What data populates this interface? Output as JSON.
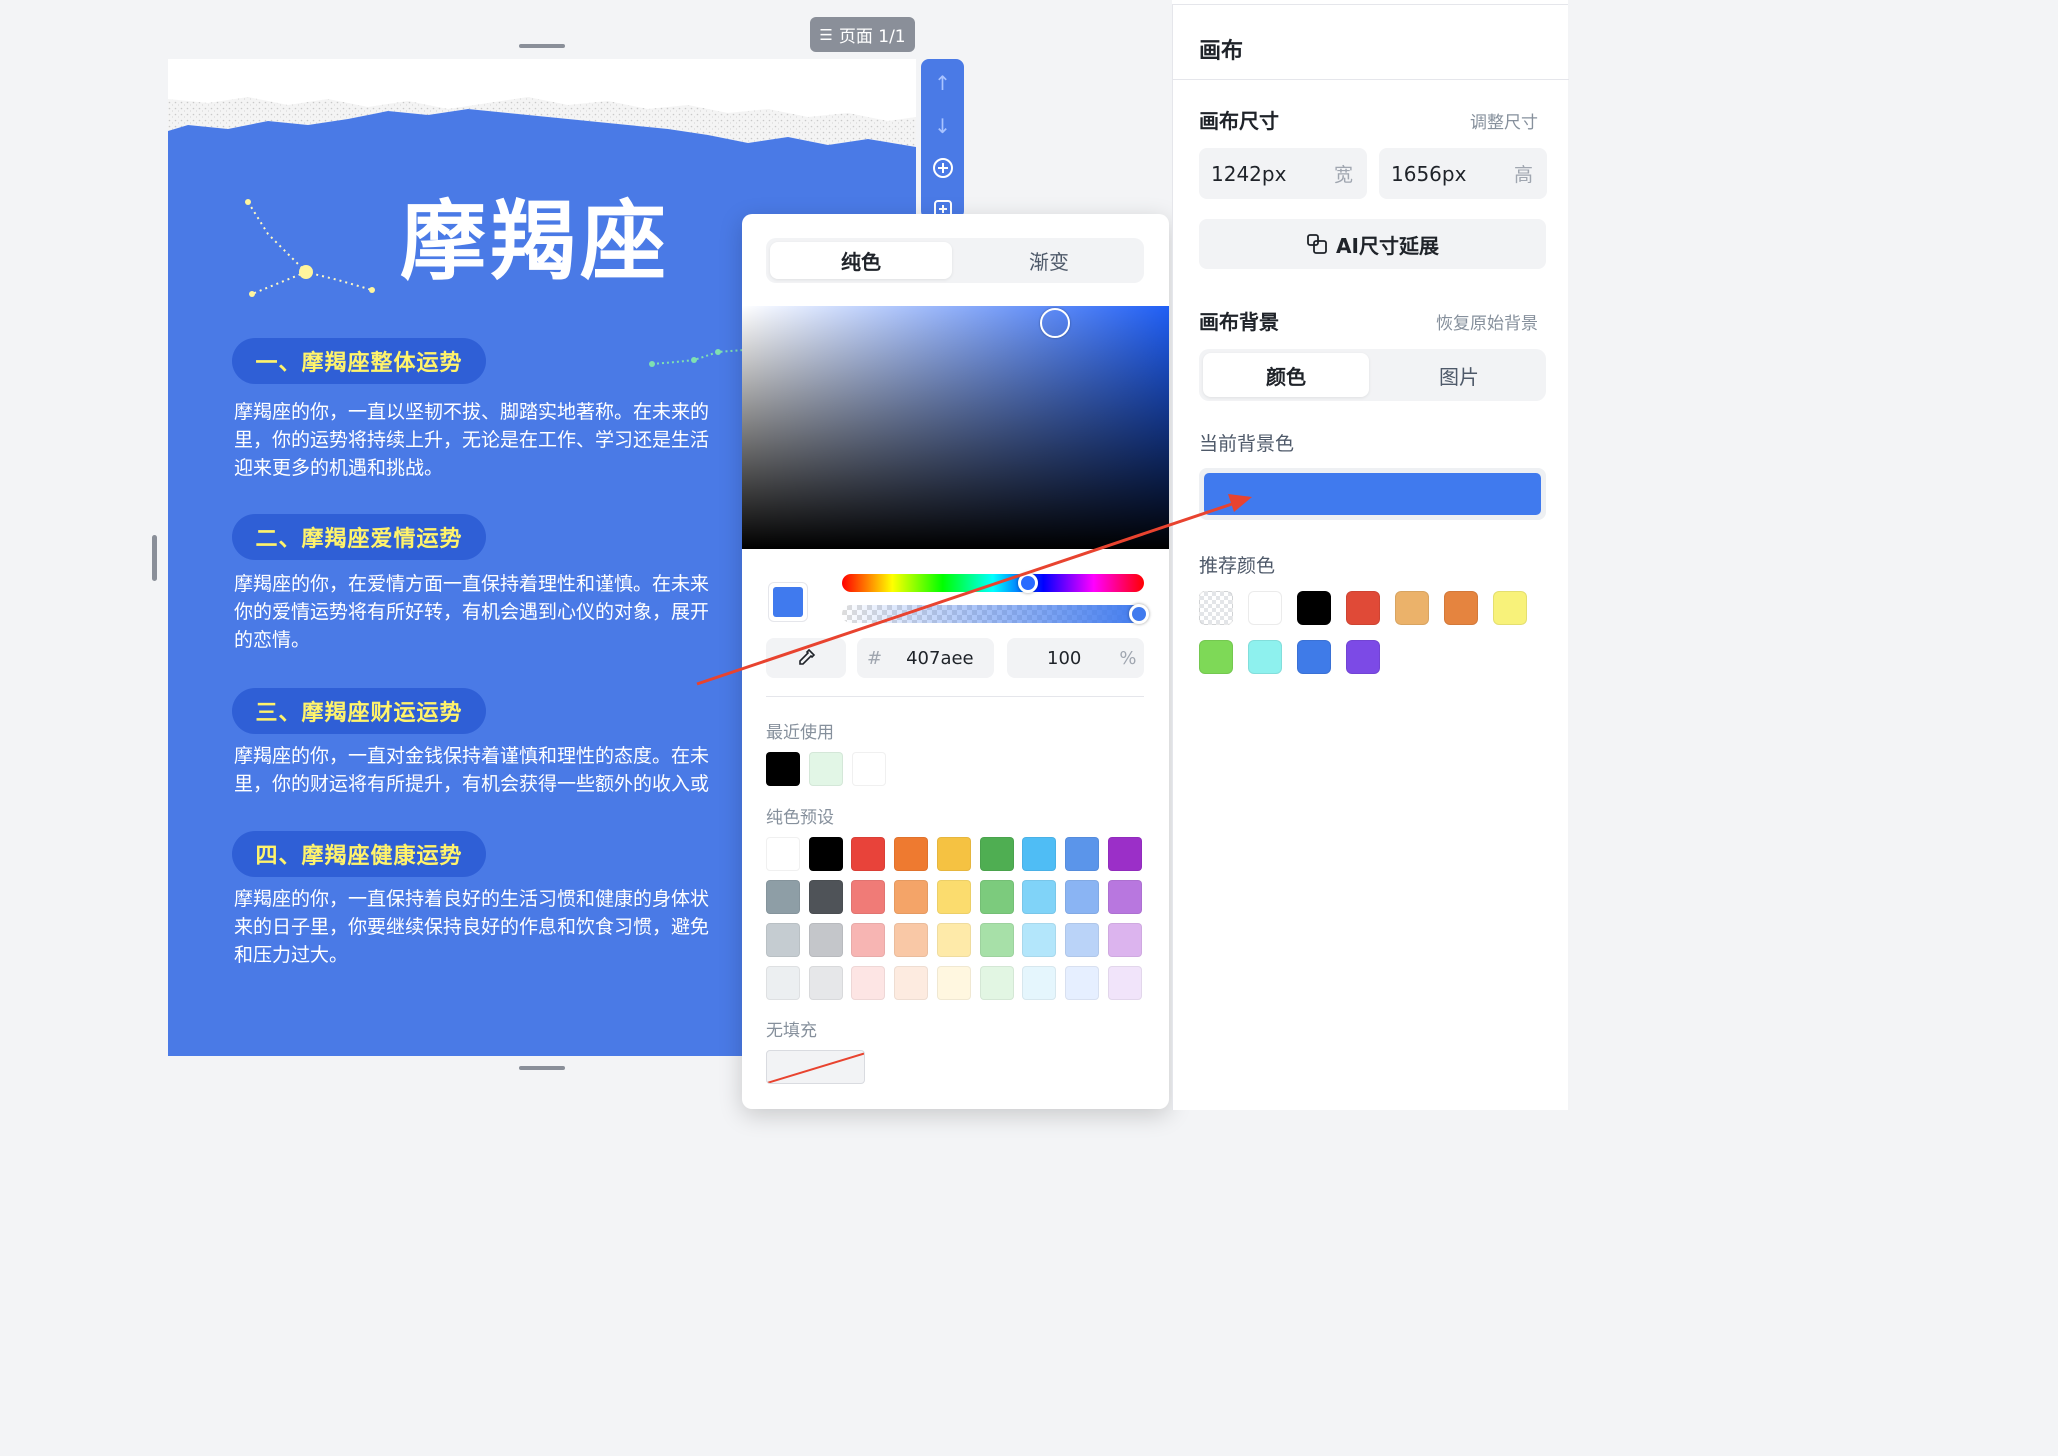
{
  "page_badge": {
    "icon": "list-icon",
    "label": "页面 1/1"
  },
  "poster": {
    "title": "摩羯座",
    "background": "#4a7ae6",
    "sections": [
      {
        "heading": "一、摩羯座整体运势",
        "text": "摩羯座的你，一直以坚韧不拔、脚踏实地著称。在未来的\n里，你的运势将持续上升，无论是在工作、学习还是生活\n迎来更多的机遇和挑战。"
      },
      {
        "heading": "二、摩羯座爱情运势",
        "text": "摩羯座的你，在爱情方面一直保持着理性和谨慎。在未来\n你的爱情运势将有所好转，有机会遇到心仪的对象，展开\n的恋情。"
      },
      {
        "heading": "三、摩羯座财运运势",
        "text": "摩羯座的你，一直对金钱保持着谨慎和理性的态度。在未\n里，你的财运将有所提升，有机会获得一些额外的收入或"
      },
      {
        "heading": "四、摩羯座健康运势",
        "text": "摩羯座的你，一直保持着良好的生活习惯和健康的身体状\n来的日子里，你要继续保持良好的作息和饮食习惯，避免\n和压力过大。"
      }
    ]
  },
  "page_tools": [
    "arrow-up-icon",
    "arrow-down-icon",
    "add-page-icon",
    "duplicate-page-icon"
  ],
  "picker": {
    "tabs": [
      {
        "label": "纯色",
        "active": true
      },
      {
        "label": "渐变",
        "active": false
      }
    ],
    "current_color": "#407aee",
    "hex_prefix": "#",
    "hex_value": "407aee",
    "opacity_value": "100",
    "opacity_unit": "%",
    "recent_label": "最近使用",
    "recent_colors": [
      "#000000",
      "#e2f6e6",
      "#ffffff"
    ],
    "preset_label": "纯色预设",
    "preset_rows": [
      [
        "#ffffff",
        "#000000",
        "#e8433a",
        "#ee7a30",
        "#f5c242",
        "#4fae52",
        "#4fbdf5",
        "#5b95ea",
        "#9b2fc8"
      ],
      [
        "#8e9ea6",
        "#4f5358",
        "#f07b77",
        "#f4a468",
        "#fbdc6e",
        "#7ccb7d",
        "#80d3f8",
        "#8ab4f3",
        "#b877df"
      ],
      [
        "#c5ccd1",
        "#c4c6ca",
        "#f7b5b3",
        "#f9c8a6",
        "#feeaa9",
        "#a7e0a8",
        "#b3e6fb",
        "#bad3f8",
        "#dcb4ee"
      ],
      [
        "#eceff1",
        "#e6e7e9",
        "#fde5e4",
        "#fdebe0",
        "#fff7e0",
        "#e2f6e3",
        "#e5f6fd",
        "#e6efff",
        "#f1e4fa"
      ]
    ],
    "nofill_label": "无填充"
  },
  "panel": {
    "title": "画布",
    "size_heading": "画布尺寸",
    "size_link": "调整尺寸",
    "width_value": "1242px",
    "width_unit": "宽",
    "height_value": "1656px",
    "height_unit": "高",
    "ai_button": "AI尺寸延展",
    "bg_heading": "画布背景",
    "bg_link": "恢复原始背景",
    "bg_tabs": [
      {
        "label": "颜色",
        "active": true
      },
      {
        "label": "图片",
        "active": false
      }
    ],
    "current_bg_label": "当前背景色",
    "current_bg_color": "#407aee",
    "recommend_label": "推荐颜色",
    "recommend_colors": [
      "transparent",
      "#ffffff",
      "#000000",
      "#e04a37",
      "#ebb26a",
      "#e5843f",
      "#f8f27a",
      "#7ed957",
      "#8ef1ee",
      "#3f7be8",
      "#7c4ae6"
    ]
  },
  "annotation_color": "#e8432f"
}
